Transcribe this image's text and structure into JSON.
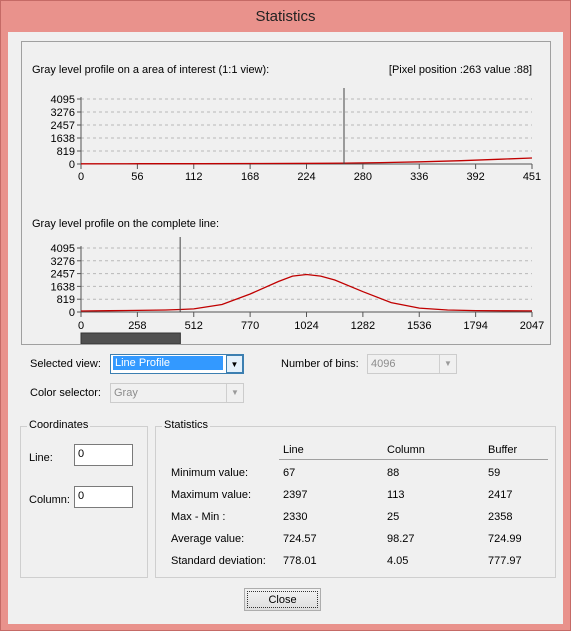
{
  "window": {
    "title": "Statistics"
  },
  "chart_data": [
    {
      "type": "line",
      "title": "Gray level profile on a area of interest (1:1 view):",
      "annotation": "[Pixel position :263  value :88]",
      "cursor_x": 263,
      "xlim": [
        0,
        451
      ],
      "ylim": [
        0,
        4095
      ],
      "x_ticks": [
        "0",
        "56",
        "112",
        "168",
        "224",
        "280",
        "336",
        "392",
        "451"
      ],
      "y_ticks": [
        "4095",
        "3276",
        "2457",
        "1638",
        "819",
        "0"
      ],
      "grid": true,
      "series": [
        {
          "x": [
            0,
            60,
            120,
            180,
            240,
            263,
            300,
            340,
            380,
            420,
            451
          ],
          "y": [
            15,
            18,
            22,
            30,
            45,
            55,
            90,
            140,
            210,
            300,
            380
          ]
        }
      ]
    },
    {
      "type": "line",
      "title": "Gray level profile on the complete line:",
      "cursor_x": 450,
      "xlim": [
        0,
        2047
      ],
      "ylim": [
        0,
        4095
      ],
      "x_ticks": [
        "0",
        "258",
        "512",
        "770",
        "1024",
        "1282",
        "1536",
        "1794",
        "2047"
      ],
      "y_ticks": [
        "4095",
        "3276",
        "2457",
        "1638",
        "819",
        "0"
      ],
      "grid": true,
      "series": [
        {
          "x": [
            0,
            128,
            256,
            384,
            450,
            512,
            640,
            768,
            896,
            960,
            1024,
            1088,
            1152,
            1280,
            1408,
            1536,
            1664,
            1792,
            1920,
            2047
          ],
          "y": [
            67,
            80,
            100,
            130,
            160,
            200,
            480,
            1150,
            1950,
            2300,
            2397,
            2300,
            2050,
            1300,
            600,
            250,
            130,
            90,
            75,
            70
          ]
        }
      ],
      "scroll_range": [
        0,
        451
      ]
    }
  ],
  "controls": {
    "selected_view_label": "Selected view:",
    "selected_view_value": "Line Profile",
    "number_of_bins_label": "Number of bins:",
    "number_of_bins_value": "4096",
    "color_selector_label": "Color selector:",
    "color_selector_value": "Gray"
  },
  "coordinates": {
    "title": "Coordinates",
    "line_label": "Line:",
    "line_value": "0",
    "column_label": "Column:",
    "column_value": "0"
  },
  "statistics": {
    "title": "Statistics",
    "columns": [
      "Line",
      "Column",
      "Buffer"
    ],
    "rows": [
      {
        "label": "Minimum value:",
        "values": [
          "67",
          "88",
          "59"
        ]
      },
      {
        "label": "Maximum value:",
        "values": [
          "2397",
          "113",
          "2417"
        ]
      },
      {
        "label": "Max - Min :",
        "values": [
          "2330",
          "25",
          "2358"
        ]
      },
      {
        "label": "Average value:",
        "values": [
          "724.57",
          "98.27",
          "724.99"
        ]
      },
      {
        "label": "Standard deviation:",
        "values": [
          "778.01",
          "4.05",
          "777.97"
        ]
      }
    ]
  },
  "buttons": {
    "close": "Close"
  }
}
